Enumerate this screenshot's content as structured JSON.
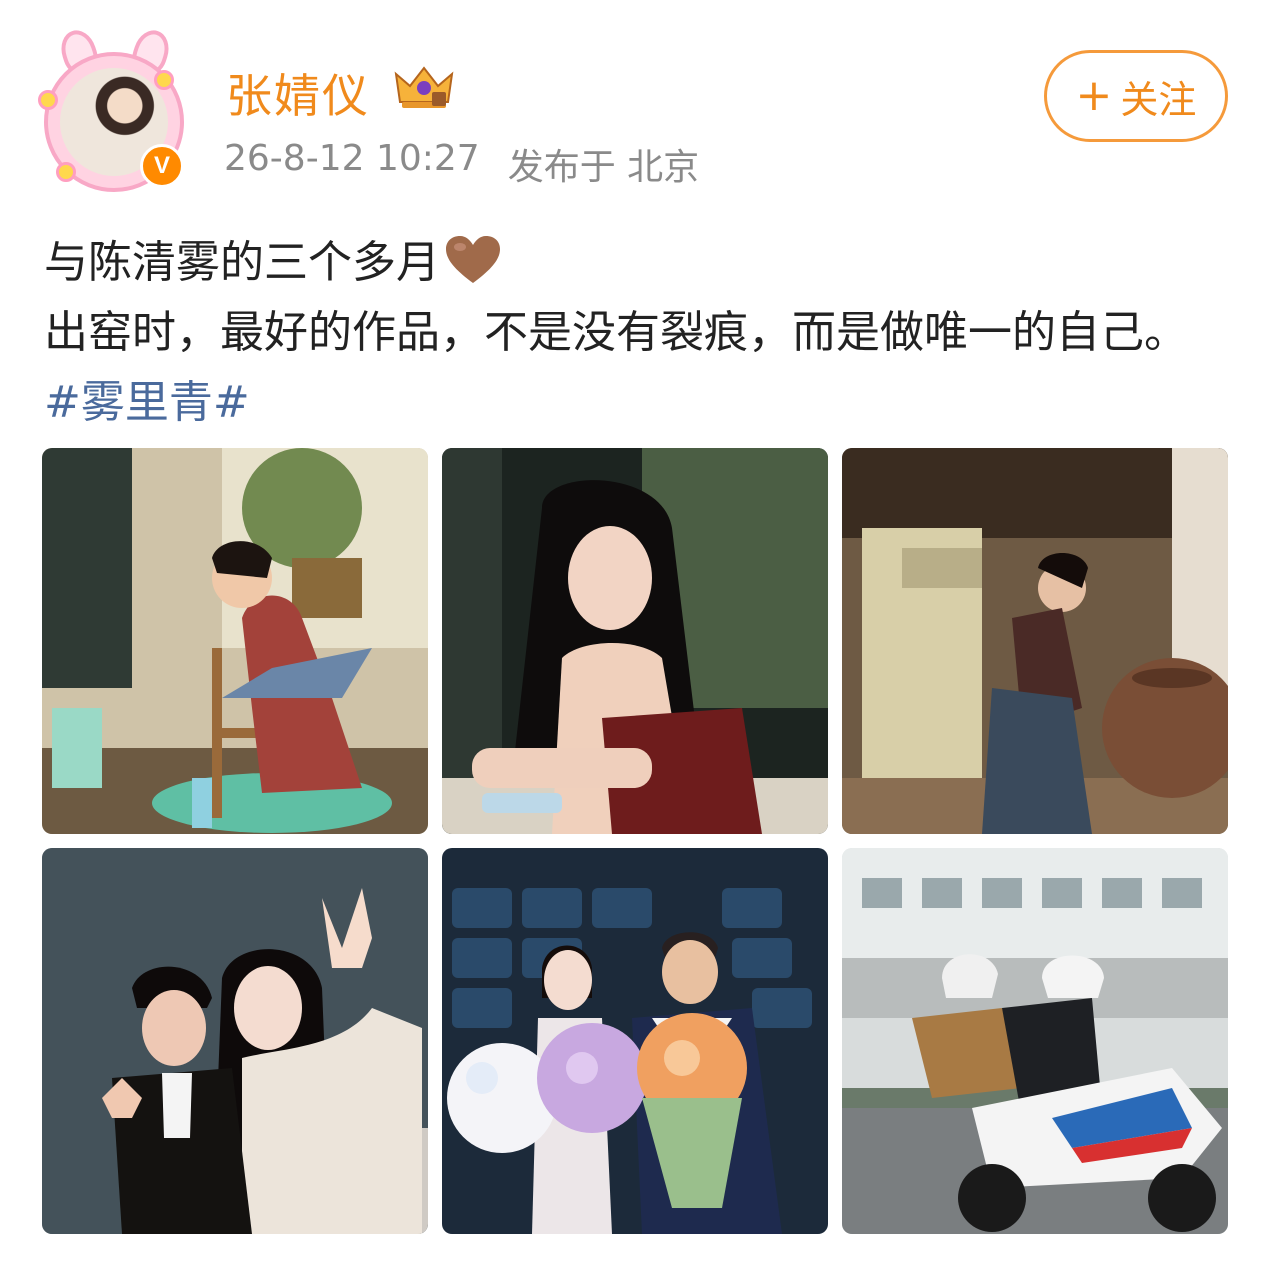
{
  "post": {
    "author": {
      "name": "张婧仪",
      "avatar_icon": "avatar-bunny-frame",
      "badge_icon": "verified-v-icon",
      "badge_label": "V",
      "level_icon": "crown-icon"
    },
    "timestamp": "26-8-12 10:27",
    "location": "发布于 北京",
    "follow": {
      "plus": "+",
      "label": "关注"
    },
    "text": {
      "line1": "与陈清雾的三个多月",
      "line1_emoji": "brown-heart-icon",
      "line2": "出窑时，最好的作品，不是没有裂痕，而是做唯一的自己。",
      "hashtag": "#雾里青#"
    },
    "photos": [
      {
        "name": "photo-pottery-studio"
      },
      {
        "name": "photo-window-portrait"
      },
      {
        "name": "photo-clay-pot"
      },
      {
        "name": "photo-peace-sign-duo"
      },
      {
        "name": "photo-flowers-cinema"
      },
      {
        "name": "photo-motorcycle-track"
      }
    ]
  },
  "colors": {
    "accent": "#f08a1c",
    "hashtag": "#4a6a9c",
    "meta": "#8a8a8a"
  }
}
